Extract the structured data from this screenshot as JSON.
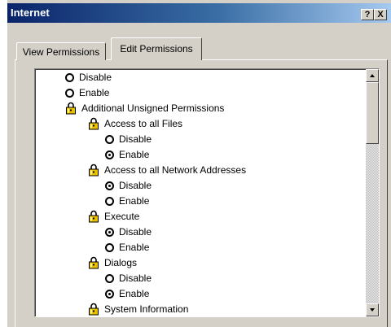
{
  "window": {
    "title": "Internet",
    "help_button": "?",
    "close_button": "X"
  },
  "tabs": [
    {
      "label": "View Permissions",
      "active": false
    },
    {
      "label": "Edit Permissions",
      "active": true
    }
  ],
  "tree": [
    {
      "type": "radio",
      "label": "Disable",
      "checked": false,
      "level": 2
    },
    {
      "type": "radio",
      "label": "Enable",
      "checked": false,
      "level": 2
    },
    {
      "type": "group",
      "label": "Additional Unsigned Permissions",
      "level": 2
    },
    {
      "type": "group",
      "label": "Access to all Files",
      "level": 3
    },
    {
      "type": "radio",
      "label": "Disable",
      "checked": false,
      "level": 4
    },
    {
      "type": "radio",
      "label": "Enable",
      "checked": true,
      "level": 4
    },
    {
      "type": "group",
      "label": "Access to all Network Addresses",
      "level": 3
    },
    {
      "type": "radio",
      "label": "Disable",
      "checked": true,
      "level": 4
    },
    {
      "type": "radio",
      "label": "Enable",
      "checked": false,
      "level": 4
    },
    {
      "type": "group",
      "label": "Execute",
      "level": 3
    },
    {
      "type": "radio",
      "label": "Disable",
      "checked": true,
      "level": 4
    },
    {
      "type": "radio",
      "label": "Enable",
      "checked": false,
      "level": 4
    },
    {
      "type": "group",
      "label": "Dialogs",
      "level": 3
    },
    {
      "type": "radio",
      "label": "Disable",
      "checked": false,
      "level": 4
    },
    {
      "type": "radio",
      "label": "Enable",
      "checked": true,
      "level": 4
    },
    {
      "type": "group",
      "label": "System Information",
      "level": 3
    }
  ],
  "icons": {
    "group": "lock-icon",
    "radio": "radio-button"
  },
  "colors": {
    "titlebar_start": "#0a246a",
    "titlebar_end": "#a6caf0",
    "dialog_face": "#d4d0c8",
    "lock_gold": "#e8c000"
  }
}
